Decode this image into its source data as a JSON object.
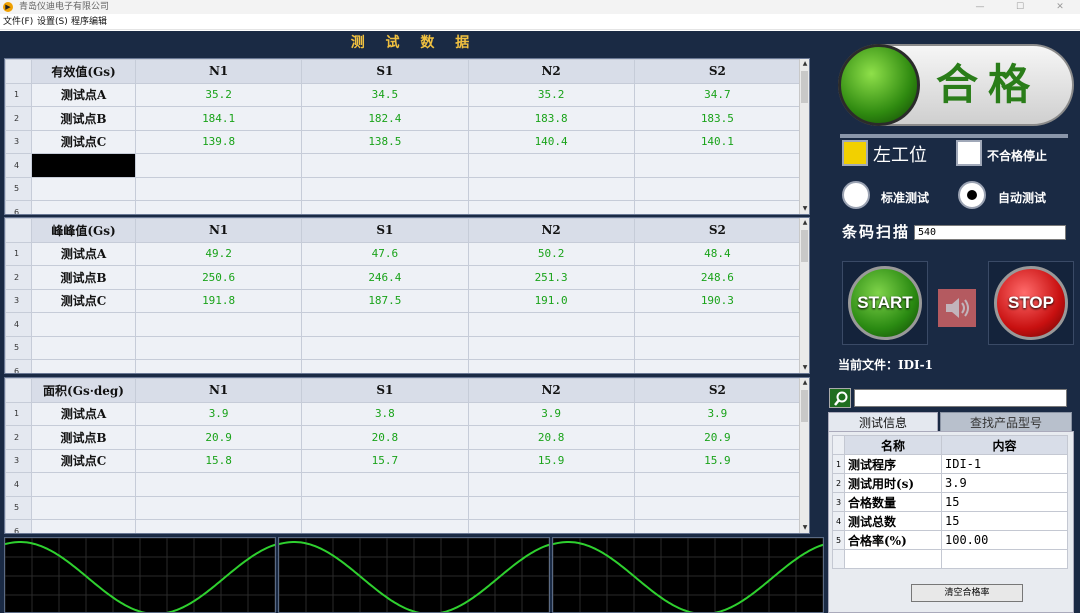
{
  "window": {
    "title": "青岛仪迪电子有限公司",
    "app_icon": "▶",
    "min": "—",
    "max": "☐",
    "close": "✕"
  },
  "menu": [
    "文件(F)",
    "设置(S)",
    "程序编辑"
  ],
  "section_title": "测 试 数 据",
  "columns": [
    "N1",
    "S1",
    "N2",
    "S2"
  ],
  "tables": [
    {
      "header": "有效值(Gs)",
      "rows": [
        {
          "num": "1",
          "label": "测试点A",
          "values": [
            "35.2",
            "34.5",
            "35.2",
            "34.7"
          ]
        },
        {
          "num": "2",
          "label": "测试点B",
          "values": [
            "184.1",
            "182.4",
            "183.8",
            "183.5"
          ]
        },
        {
          "num": "3",
          "label": "测试点C",
          "values": [
            "139.8",
            "138.5",
            "140.4",
            "140.1"
          ]
        },
        {
          "num": "4",
          "label": "",
          "values": [
            "",
            "",
            "",
            ""
          ]
        },
        {
          "num": "5",
          "label": "",
          "values": [
            "",
            "",
            "",
            ""
          ]
        },
        {
          "num": "6",
          "label": "",
          "values": [
            "",
            "",
            "",
            ""
          ]
        }
      ]
    },
    {
      "header": "峰峰值(Gs)",
      "rows": [
        {
          "num": "1",
          "label": "测试点A",
          "values": [
            "49.2",
            "47.6",
            "50.2",
            "48.4"
          ]
        },
        {
          "num": "2",
          "label": "测试点B",
          "values": [
            "250.6",
            "246.4",
            "251.3",
            "248.6"
          ]
        },
        {
          "num": "3",
          "label": "测试点C",
          "values": [
            "191.8",
            "187.5",
            "191.0",
            "190.3"
          ]
        },
        {
          "num": "4",
          "label": "",
          "values": [
            "",
            "",
            "",
            ""
          ]
        },
        {
          "num": "5",
          "label": "",
          "values": [
            "",
            "",
            "",
            ""
          ]
        },
        {
          "num": "6",
          "label": "",
          "values": [
            "",
            "",
            "",
            ""
          ]
        }
      ]
    },
    {
      "header": "面积(Gs·deg)",
      "rows": [
        {
          "num": "1",
          "label": "测试点A",
          "values": [
            "3.9",
            "3.8",
            "3.9",
            "3.9"
          ]
        },
        {
          "num": "2",
          "label": "测试点B",
          "values": [
            "20.9",
            "20.8",
            "20.8",
            "20.9"
          ]
        },
        {
          "num": "3",
          "label": "测试点C",
          "values": [
            "15.8",
            "15.7",
            "15.9",
            "15.9"
          ]
        },
        {
          "num": "4",
          "label": "",
          "values": [
            "",
            "",
            "",
            ""
          ]
        },
        {
          "num": "5",
          "label": "",
          "values": [
            "",
            "",
            "",
            ""
          ]
        },
        {
          "num": "6",
          "label": "",
          "values": [
            "",
            "",
            "",
            ""
          ]
        }
      ]
    }
  ],
  "status": {
    "result": "合格",
    "light_color": "#2f8a10"
  },
  "options": {
    "left_station": "左工位",
    "left_station_color": "#f2d000",
    "stop_on_fail": "不合格停止",
    "mode_standard": "标准测试",
    "mode_auto": "自动测试",
    "selected_mode": "auto"
  },
  "barcode": {
    "label": "条码扫描",
    "value": "540"
  },
  "controls": {
    "start": "START",
    "stop": "STOP",
    "speaker_icon": "speaker-icon"
  },
  "current_file": {
    "label": "当前文件：",
    "value": "IDI-1"
  },
  "tabs": [
    "测试信息",
    "查找产品型号"
  ],
  "info": {
    "headers": [
      "名称",
      "内容"
    ],
    "rows": [
      {
        "num": "1",
        "name": "测试程序",
        "value": "IDI-1"
      },
      {
        "num": "2",
        "name": "测试用时(s)",
        "value": "3.9"
      },
      {
        "num": "3",
        "name": "合格数量",
        "value": "15"
      },
      {
        "num": "4",
        "name": "测试总数",
        "value": "15"
      },
      {
        "num": "5",
        "name": "合格率(%)",
        "value": "100.00"
      }
    ],
    "clear_button": "清空合格率"
  },
  "waveform": {
    "color": "#2fd02f",
    "grid_color": "#2a2a2a",
    "panels": 3
  }
}
